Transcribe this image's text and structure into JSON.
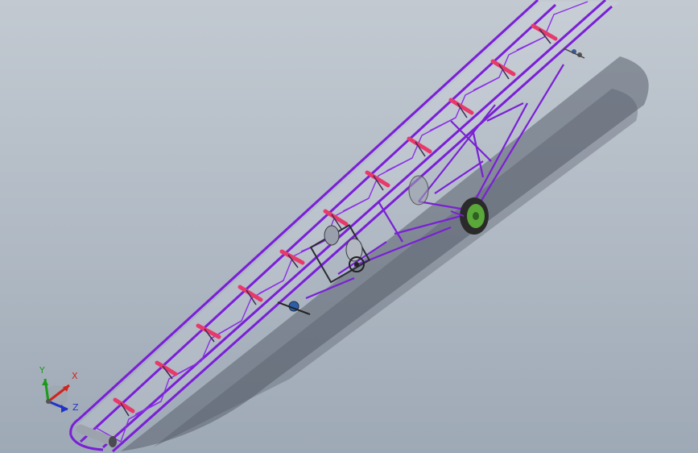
{
  "scene": {
    "background_top": "#c2c9d1",
    "background_bottom": "#9ea9b6",
    "frame_color": "#7a1fd6",
    "roller_color": "#e8396b",
    "wheel_hub_color": "#5aa83a",
    "tire_color": "#2a2a2a"
  },
  "triad": {
    "x_label": "X",
    "y_label": "Y",
    "z_label": "Z",
    "x_color": "#d0241c",
    "y_color": "#1c9a1c",
    "z_color": "#2233c8"
  }
}
